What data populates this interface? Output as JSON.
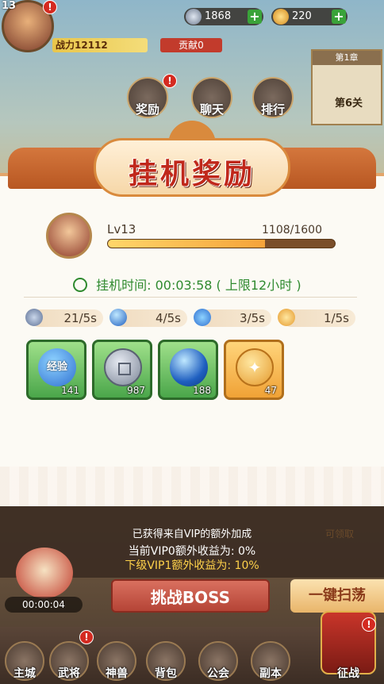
{
  "topbar": {
    "player_level": "13",
    "power_label": "战力12112",
    "contribution_label": "贡献0",
    "resource_1": "1868",
    "resource_2": "220",
    "plus_icon": "+",
    "badge_icon": "!"
  },
  "menu": {
    "reward_label": "奖励",
    "chat_label": "聊天",
    "rank_label": "排行"
  },
  "chapter": {
    "title": "第1章",
    "stage": "第6关"
  },
  "popup": {
    "title": "挂机奖励",
    "hero_level": "Lv13",
    "exp_text": "1108/1600",
    "exp_fraction": 0.6925,
    "timer_label": "挂机时间:",
    "timer_value": "00:03:58",
    "timer_limit": "( 上限12小时 )",
    "rates": [
      {
        "icon": "exp-book-icon",
        "value": "21/5s"
      },
      {
        "icon": "blue-orb-icon",
        "value": "4/5s"
      },
      {
        "icon": "exp-icon",
        "value": "3/5s"
      },
      {
        "icon": "gold-coin-icon",
        "value": "1/5s"
      }
    ],
    "items": [
      {
        "icon": "exp-orb-icon",
        "label": "经验",
        "count": "141"
      },
      {
        "icon": "silver-coin-icon",
        "count": "987"
      },
      {
        "icon": "blue-orb-icon",
        "count": "188"
      },
      {
        "icon": "gold-star-coin-icon",
        "count": "47"
      }
    ]
  },
  "vip": {
    "heading": "已获得来自VIP的额外加成",
    "current": "当前VIP0额外收益为:  0%",
    "next": "下级VIP1额外收益为:  10%",
    "claim": "可领取"
  },
  "actions": {
    "boss": "挑战BOSS",
    "sweep": "一键扫荡",
    "idle_timer": "00:00:04"
  },
  "nav": {
    "items": [
      "主城",
      "武将",
      "神兽",
      "背包",
      "公会",
      "副本",
      "征战"
    ]
  },
  "colors": {
    "accent_red": "#c0281b",
    "timer_green": "#2f8a2f",
    "vip_yellow": "#ffd24a"
  }
}
